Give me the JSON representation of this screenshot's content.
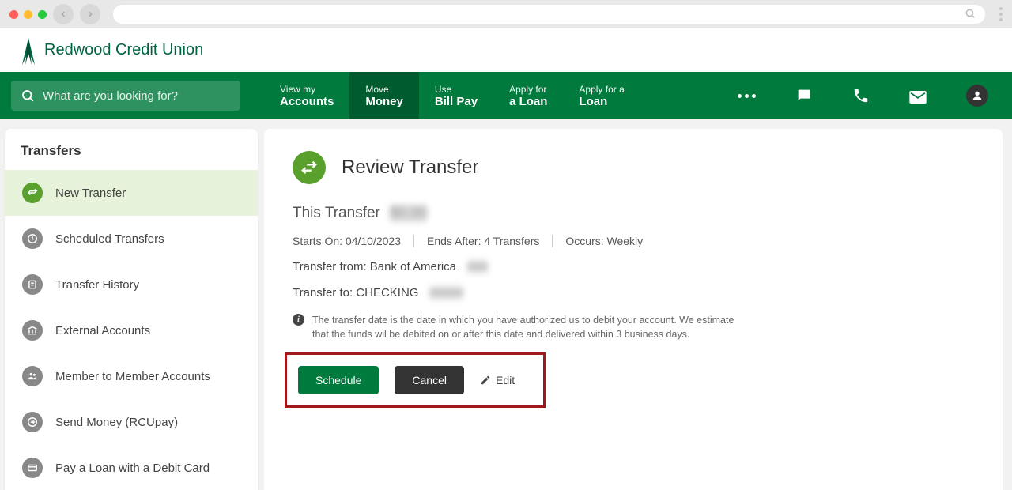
{
  "brand": {
    "name": "Redwood Credit Union"
  },
  "search": {
    "placeholder": "What are you looking for?"
  },
  "nav": {
    "items": [
      {
        "small": "View my",
        "big": "Accounts"
      },
      {
        "small": "Move",
        "big": "Money"
      },
      {
        "small": "Use",
        "big": "Bill Pay"
      },
      {
        "small": "Apply for",
        "big": "a Loan"
      },
      {
        "small": "Apply for a",
        "big": "Loan"
      }
    ]
  },
  "sidebar": {
    "title": "Transfers",
    "items": [
      {
        "label": "New Transfer"
      },
      {
        "label": "Scheduled Transfers"
      },
      {
        "label": "Transfer History"
      },
      {
        "label": "External Accounts"
      },
      {
        "label": "Member to Member Accounts"
      },
      {
        "label": "Send Money (RCUpay)"
      },
      {
        "label": "Pay a Loan with a Debit Card"
      }
    ]
  },
  "page": {
    "title": "Review Transfer",
    "this_transfer": "This Transfer",
    "redacted_amount": "$0.00",
    "starts": "Starts On: 04/10/2023",
    "ends": "Ends After: 4 Transfers",
    "occurs": "Occurs: Weekly",
    "from_label": "Transfer from: Bank of America",
    "from_redacted": "•••••",
    "to_label": "Transfer to: CHECKING",
    "to_redacted": "••••••••",
    "info": "The transfer date is the date in which you have authorized us to debit your account. We estimate that the funds wil be debited on or after this date and delivered within 3 business days.",
    "schedule_label": "Schedule",
    "cancel_label": "Cancel",
    "edit_label": "Edit"
  }
}
